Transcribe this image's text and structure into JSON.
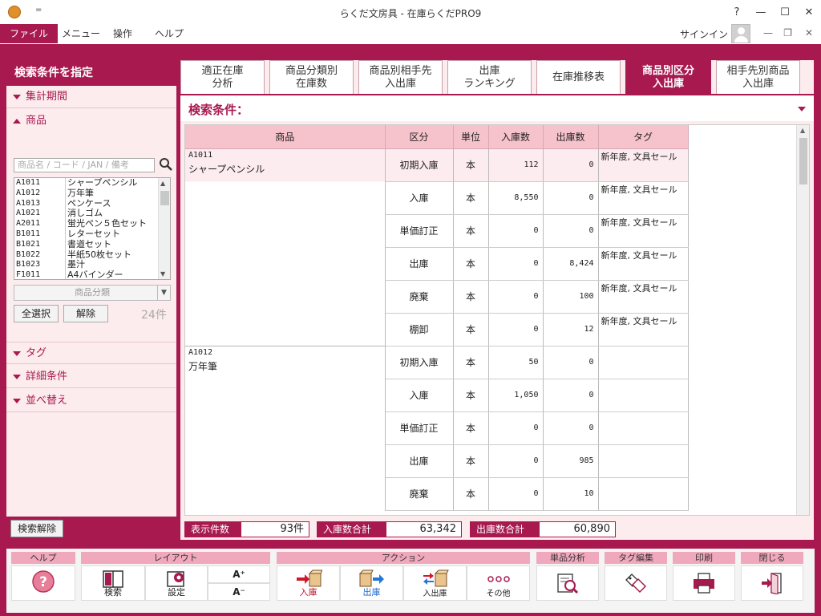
{
  "window": {
    "title": "らくだ文房具 - 在庫らくだPRO9",
    "quick_access": "=",
    "help": "?",
    "minimize": "—",
    "maximize": "☐",
    "close": "✕"
  },
  "menu": {
    "items": [
      "ファイル",
      "メニュー",
      "操作",
      "ヘルプ"
    ],
    "signin": "サインイン"
  },
  "left": {
    "header": "検索条件を指定",
    "sections": {
      "period": "集計期間",
      "product": "商品",
      "tag": "タグ",
      "detail": "詳細条件",
      "sort": "並べ替え"
    },
    "search_placeholder": "商品名 / コード / JAN / 備考",
    "items": [
      {
        "code": "A1011",
        "name": "シャープペンシル"
      },
      {
        "code": "A1012",
        "name": "万年筆"
      },
      {
        "code": "A1013",
        "name": "ペンケース"
      },
      {
        "code": "A1021",
        "name": "消しゴム"
      },
      {
        "code": "A2011",
        "name": "蛍光ペン５色セット"
      },
      {
        "code": "B1011",
        "name": "レターセット"
      },
      {
        "code": "B1021",
        "name": "書道セット"
      },
      {
        "code": "B1022",
        "name": "半紙50枚セット"
      },
      {
        "code": "B1023",
        "name": "墨汁"
      },
      {
        "code": "F1011",
        "name": "A4バインダー"
      }
    ],
    "category_placeholder": "商品分類",
    "select_all": "全選択",
    "deselect": "解除",
    "count": "24件",
    "clear_search": "検索解除"
  },
  "tabs": [
    {
      "line1": "適正在庫",
      "line2": "分析"
    },
    {
      "line1": "商品分類別",
      "line2": "在庫数"
    },
    {
      "line1": "商品別相手先",
      "line2": "入出庫"
    },
    {
      "line1": "出庫",
      "line2": "ランキング"
    },
    {
      "line1": "在庫推移表",
      "line2": ""
    },
    {
      "line1": "商品別区分",
      "line2": "入出庫"
    },
    {
      "line1": "相手先別商品",
      "line2": "入出庫"
    }
  ],
  "condition_label": "検索条件：",
  "grid": {
    "headers": [
      "商品",
      "区分",
      "単位",
      "入庫数",
      "出庫数",
      "タグ"
    ],
    "products": [
      {
        "code": "A1011",
        "name": "シャープペンシル",
        "rows": [
          {
            "kubun": "初期入庫",
            "unit": "本",
            "in": "112",
            "out": "0",
            "tag": "新年度, 文具セール"
          },
          {
            "kubun": "入庫",
            "unit": "本",
            "in": "8,550",
            "out": "0",
            "tag": "新年度, 文具セール"
          },
          {
            "kubun": "単価訂正",
            "unit": "本",
            "in": "0",
            "out": "0",
            "tag": "新年度, 文具セール"
          },
          {
            "kubun": "出庫",
            "unit": "本",
            "in": "0",
            "out": "8,424",
            "tag": "新年度, 文具セール"
          },
          {
            "kubun": "廃棄",
            "unit": "本",
            "in": "0",
            "out": "100",
            "tag": "新年度, 文具セール"
          },
          {
            "kubun": "棚卸",
            "unit": "本",
            "in": "0",
            "out": "12",
            "tag": "新年度, 文具セール"
          }
        ]
      },
      {
        "code": "A1012",
        "name": "万年筆",
        "rows": [
          {
            "kubun": "初期入庫",
            "unit": "本",
            "in": "50",
            "out": "0",
            "tag": ""
          },
          {
            "kubun": "入庫",
            "unit": "本",
            "in": "1,050",
            "out": "0",
            "tag": ""
          },
          {
            "kubun": "単価訂正",
            "unit": "本",
            "in": "0",
            "out": "0",
            "tag": ""
          },
          {
            "kubun": "出庫",
            "unit": "本",
            "in": "0",
            "out": "985",
            "tag": ""
          },
          {
            "kubun": "廃棄",
            "unit": "本",
            "in": "0",
            "out": "10",
            "tag": ""
          }
        ]
      }
    ]
  },
  "summary": {
    "count_label": "表示件数",
    "count_value": "93件",
    "in_label": "入庫数合計",
    "in_value": "63,342",
    "out_label": "出庫数合計",
    "out_value": "60,890"
  },
  "toolbar": {
    "help_group": "ヘルプ",
    "layout_group": "レイアウト",
    "search": "検索",
    "settings": "設定",
    "font_up": "A⁺",
    "font_down": "A⁻",
    "action_group": "アクション",
    "stock_in": "入庫",
    "stock_out": "出庫",
    "stock_inout": "入出庫",
    "other": "その他",
    "analysis_group": "単品分析",
    "tag_group": "タグ編集",
    "print_group": "印刷",
    "close_group": "閉じる"
  },
  "colors": {
    "brand": "#a8194f",
    "panel": "#fcecee",
    "header": "#f6c3cc"
  }
}
